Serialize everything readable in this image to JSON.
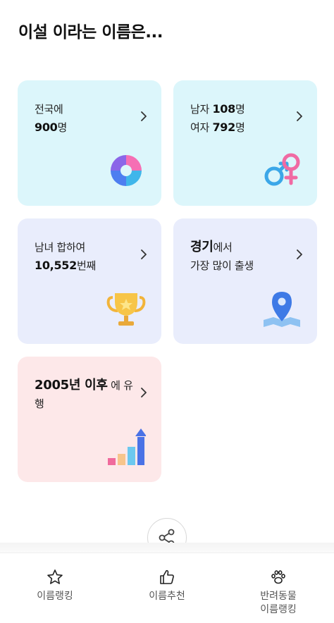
{
  "page": {
    "title": "이설 이라는 이름은..."
  },
  "cards": {
    "total": {
      "line1": "전국에",
      "count": "900",
      "count_unit": "명"
    },
    "gender": {
      "male_label": "남자 ",
      "male_count": "108",
      "male_unit": "명",
      "female_label": "여자 ",
      "female_count": "792",
      "female_unit": "명"
    },
    "rank": {
      "line1": "남녀 합하여",
      "rank": "10,552",
      "rank_unit": "번째"
    },
    "region": {
      "region": "경기",
      "suffix": "에서",
      "line2": "가장 많이 출생"
    },
    "trend": {
      "year": "2005년 이후",
      "suffix_a": " 에 유",
      "suffix_b": "행"
    }
  },
  "bottom_nav": {
    "items": [
      {
        "label": "이름랭킹",
        "icon": "star-icon"
      },
      {
        "label": "이름추천",
        "icon": "thumbs-up-icon"
      },
      {
        "label_line1": "반려동물",
        "label_line2": "이름랭킹",
        "icon": "paw-icon"
      }
    ]
  },
  "colors": {
    "card_cyan": "#dcf6fb",
    "card_lavender": "#e9edfc",
    "card_pink": "#fde8e9"
  }
}
